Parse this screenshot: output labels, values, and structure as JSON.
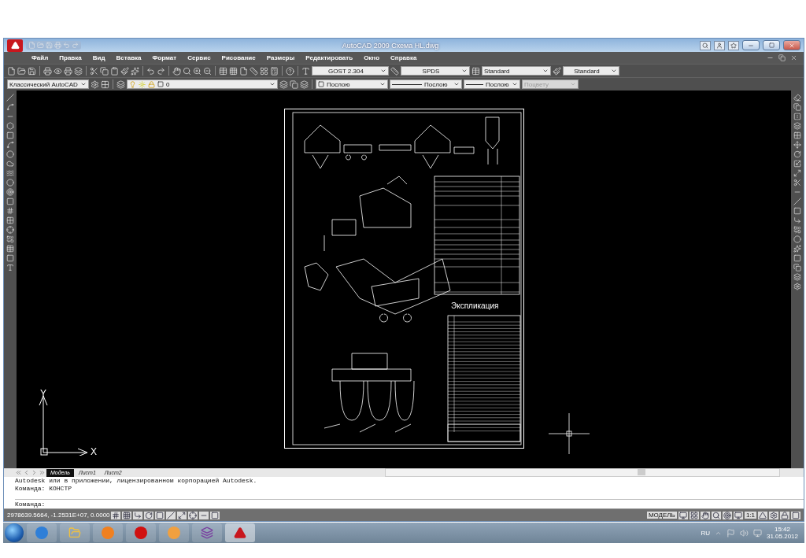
{
  "window": {
    "title": "AutoCAD 2009 Схема HL.dwg"
  },
  "menu": [
    "Файл",
    "Правка",
    "Вид",
    "Вставка",
    "Формат",
    "Сервис",
    "Рисование",
    "Размеры",
    "Редактировать",
    "Окно",
    "Справка"
  ],
  "toolbar_1": {
    "text_style": "GOST 2.304",
    "dim_style": "SPDS",
    "table_style": "Standard",
    "multileader_style": "Standard"
  },
  "toolbar_2": {
    "workspace": "Классический AutoCAD",
    "layer": "0",
    "object_color_setting": "Послою",
    "linetype": "Послою",
    "lineweight": "Послою",
    "plot_style": {
      "value": "Поцвету",
      "disabled": true
    }
  },
  "drawing": {
    "heading": "Экспликация"
  },
  "ucs": {
    "x_label": "X",
    "y_label": "Y"
  },
  "layout_tabs": [
    {
      "label": "Модель",
      "selected": true
    },
    {
      "label": "Лист1",
      "selected": false
    },
    {
      "label": "Лист2",
      "selected": false
    }
  ],
  "command_history": [
    "Autodesk или в приложении, лицензированном корпорацией Autodesk.",
    "Команда: КОНСТР"
  ],
  "command_prompt": "Команда:",
  "status_bar": {
    "coordinates": "2978639.5664, -1.2531E+07, 0.0000",
    "space": "МОДЕЛЬ",
    "annotation_scale": "1:1"
  },
  "taskbar": {
    "language": "RU",
    "time": "15:42",
    "date": "31.05.2012"
  }
}
